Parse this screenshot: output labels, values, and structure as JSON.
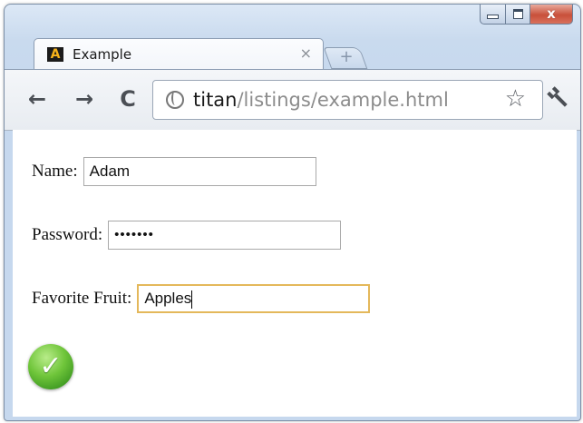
{
  "window": {
    "tab": {
      "favicon_letter": "A",
      "title": "Example",
      "close_glyph": "×"
    },
    "new_tab_glyph": "+",
    "caption": {
      "close_glyph": "x"
    }
  },
  "toolbar": {
    "back_glyph": "←",
    "forward_glyph": "→",
    "reload_glyph": "C",
    "url_host": "titan",
    "url_path": "/listings/example.html",
    "star_glyph": "☆",
    "wrench_glyph": "🔧"
  },
  "form": {
    "name_label": "Name:",
    "name_value": "Adam",
    "password_label": "Password:",
    "password_value": "•••••••",
    "fruit_label": "Favorite Fruit:",
    "fruit_value": "Apples",
    "submit_glyph": "✓"
  },
  "colors": {
    "focus_border": "#e4b85b",
    "submit_green": "#6fc53a",
    "close_red": "#c8503a"
  }
}
